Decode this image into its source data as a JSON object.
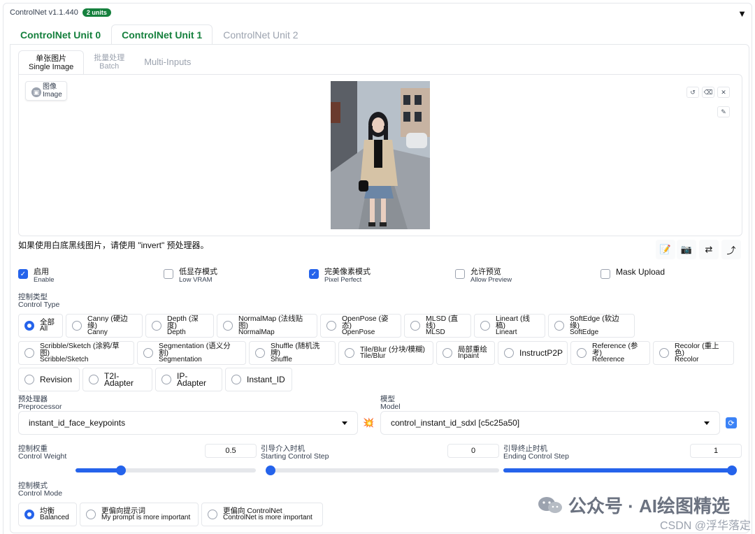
{
  "header": {
    "title": "ControlNet v1.1.440",
    "badge": "2 units",
    "collapse": "▼"
  },
  "unit_tabs": [
    "ControlNet Unit 0",
    "ControlNet Unit 1",
    "ControlNet Unit 2"
  ],
  "input_tabs": {
    "single": {
      "zh": "单张图片",
      "en": "Single Image"
    },
    "batch": {
      "zh": "批量处理",
      "en": "Batch"
    },
    "multi": "Multi-Inputs"
  },
  "image": {
    "label_zh": "图像",
    "label_en": "Image",
    "label_icon": "image-icon"
  },
  "photo_colors": {
    "sky": "#c9d2dc",
    "street": "#8a8f96",
    "coat": "#d6c3a6",
    "skirt": "#6b86a6",
    "hair": "#1b1b1f"
  },
  "hint": "如果使用白底黑线图片，请使用 \"invert\" 预处理器。",
  "checks": [
    {
      "zh": "启用",
      "en": "Enable",
      "checked": true
    },
    {
      "zh": "低显存模式",
      "en": "Low VRAM",
      "checked": false
    },
    {
      "zh": "完美像素模式",
      "en": "Pixel Perfect",
      "checked": true
    },
    {
      "zh": "允许预览",
      "en": "Allow Preview",
      "checked": false
    },
    {
      "zh": "Mask Upload",
      "en": "",
      "checked": false
    }
  ],
  "control_type": {
    "zh": "控制类型",
    "en": "Control Type"
  },
  "types": [
    {
      "zh": "全部",
      "en": "All",
      "on": true
    },
    {
      "zh": "Canny (硬边缘)",
      "en": "Canny"
    },
    {
      "zh": "Depth (深度)",
      "en": "Depth"
    },
    {
      "zh": "NormalMap (法线贴图)",
      "en": "NormalMap"
    },
    {
      "zh": "OpenPose (姿态)",
      "en": "OpenPose"
    },
    {
      "zh": "MLSD (直线)",
      "en": "MLSD"
    },
    {
      "zh": "Lineart (线稿)",
      "en": "Lineart"
    },
    {
      "zh": "SoftEdge (软边缘)",
      "en": "SoftEdge"
    },
    {
      "zh": "Scribble/Sketch (涂鸦/草图)",
      "en": "Scribble/Sketch"
    },
    {
      "zh": "Segmentation (语义分割)",
      "en": "Segmentation"
    },
    {
      "zh": "Shuffle (随机洗牌)",
      "en": "Shuffle"
    },
    {
      "zh": "Tile/Blur (分块/模糊)",
      "en": "Tile/Blur"
    },
    {
      "zh": "局部重绘",
      "en": "Inpaint"
    },
    {
      "zh": "InstructP2P",
      "en": ""
    },
    {
      "zh": "Reference (参考)",
      "en": "Reference"
    },
    {
      "zh": "Recolor (重上色)",
      "en": "Recolor"
    },
    {
      "zh": "Revision",
      "en": ""
    },
    {
      "zh": "T2I-Adapter",
      "en": ""
    },
    {
      "zh": "IP-Adapter",
      "en": ""
    },
    {
      "zh": "Instant_ID",
      "en": ""
    }
  ],
  "preprocessor": {
    "zh": "预处理器",
    "en": "Preprocessor",
    "value": "instant_id_face_keypoints"
  },
  "model": {
    "zh": "模型",
    "en": "Model",
    "value": "control_instant_id_sdxl [c5c25a50]"
  },
  "sliders": [
    {
      "zh": "控制权重",
      "en": "Control Weight",
      "value": "0.5",
      "fraction": 0.25
    },
    {
      "zh": "引导介入时机",
      "en": "Starting Control Step",
      "value": "0",
      "fraction": 0.0
    },
    {
      "zh": "引导终止时机",
      "en": "Ending Control Step",
      "value": "1",
      "fraction": 1.0
    }
  ],
  "control_mode": {
    "zh": "控制模式",
    "en": "Control Mode"
  },
  "modes": [
    {
      "zh": "均衡",
      "en": "Balanced",
      "on": true
    },
    {
      "zh": "更偏向提示词",
      "en": "My prompt is more important"
    },
    {
      "zh": "更偏向 ControlNet",
      "en": "ControlNet is more important"
    }
  ],
  "watermark": {
    "main": "公众号 · AI绘图精选",
    "sub": "CSDN @浮华落定"
  },
  "icons": {
    "reset": "↺",
    "erase": "⌫",
    "close": "✕",
    "brush": "✎",
    "edit": "📝",
    "camera": "📷",
    "swap": "⇄",
    "send": "⤴",
    "boom": "💥",
    "refresh": "⟳"
  }
}
